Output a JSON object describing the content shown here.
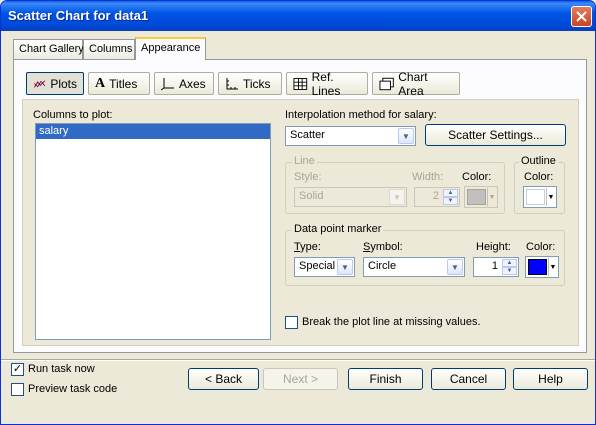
{
  "window": {
    "title": "Scatter Chart for data1"
  },
  "tabs": [
    {
      "label": "Chart Gallery"
    },
    {
      "label": "Columns"
    },
    {
      "label": "Appearance"
    }
  ],
  "subtabs": [
    {
      "label": "Plots",
      "icon": "plots-icon"
    },
    {
      "label": "Titles",
      "icon": "titles-icon"
    },
    {
      "label": "Axes",
      "icon": "axes-icon"
    },
    {
      "label": "Ticks",
      "icon": "ticks-icon"
    },
    {
      "label": "Ref. Lines",
      "icon": "reflines-icon"
    },
    {
      "label": "Chart Area",
      "icon": "chartarea-icon"
    }
  ],
  "plots": {
    "columns_label": "Columns to plot:",
    "columns": [
      "salary"
    ],
    "interp_label": "Interpolation method for salary:",
    "interp_value": "Scatter",
    "scatter_settings_label": "Scatter Settings...",
    "line": {
      "group_label": "Line",
      "style_label": "Style:",
      "style_value": "Solid",
      "width_label": "Width:",
      "width_value": "2",
      "color_label": "Color:",
      "color": "#c0c0c0"
    },
    "outline": {
      "group_label": "Outline",
      "color_label": "Color:",
      "color": "#ffffff"
    },
    "marker": {
      "group_label": "Data point marker",
      "type_label": "Type:",
      "type_value": "Special",
      "symbol_label": "Symbol:",
      "symbol_value": "Circle",
      "height_label": "Height:",
      "height_value": "1",
      "color_label": "Color:",
      "color": "#0000ff"
    },
    "break_label": "Break the plot line at missing values.",
    "break_checked": false
  },
  "footer": {
    "run_label": "Run task now",
    "run_checked": true,
    "preview_label": "Preview task code",
    "preview_checked": false,
    "back_label": "< Back",
    "next_label": "Next >",
    "finish_label": "Finish",
    "cancel_label": "Cancel",
    "help_label": "Help"
  }
}
